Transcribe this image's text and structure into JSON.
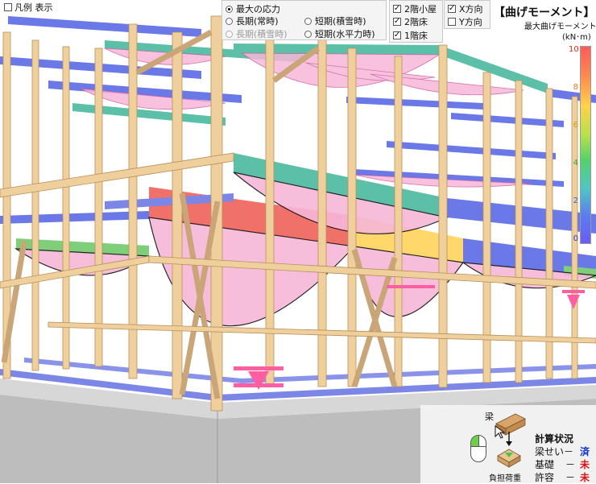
{
  "legend_toggle": {
    "label": "凡例 表示",
    "checked": false
  },
  "load_case": {
    "options": [
      {
        "label": "最大の応力",
        "selected": true,
        "enabled": true
      },
      {
        "label": "長期(常時)",
        "selected": false,
        "enabled": true
      },
      {
        "label": "短期(積雪時)",
        "selected": false,
        "enabled": true
      },
      {
        "label": "長期(積雪時)",
        "selected": false,
        "enabled": false
      },
      {
        "label": "短期(水平力時)",
        "selected": false,
        "enabled": true
      }
    ]
  },
  "floors": {
    "items": [
      {
        "label": "2階小屋",
        "checked": true
      },
      {
        "label": "2階床",
        "checked": true
      },
      {
        "label": "1階床",
        "checked": true
      }
    ]
  },
  "directions": {
    "items": [
      {
        "label": "X方向",
        "checked": true
      },
      {
        "label": "Y方向",
        "checked": false
      }
    ]
  },
  "color_scale": {
    "title": "【曲げモーメント】",
    "subtitle": "最大曲げモーメント",
    "unit": "(kN･m)",
    "ticks": [
      "10",
      "8",
      "6",
      "4",
      "2",
      "0"
    ],
    "tick_colors": [
      "#e0281e",
      "#e0781e",
      "#d0a000",
      "#3aa84a",
      "#2a6ad0",
      "#2a3ad0"
    ],
    "gradient": [
      "#ff5a5a",
      "#ff8a50",
      "#ffd24a",
      "#b7e04a",
      "#52d26b",
      "#4fc7c3",
      "#5b7cf0",
      "#6a5cf5"
    ]
  },
  "widget": {
    "beam_label": "梁",
    "load_label": "負担荷重",
    "status_title": "計算状況",
    "rows": [
      {
        "label": "梁せい",
        "dash": "－",
        "status": "済",
        "color": "#1030d0"
      },
      {
        "label": "基礎",
        "dash": "－",
        "status": "未",
        "color": "#e01010"
      },
      {
        "label": "許容",
        "dash": "－",
        "status": "未",
        "color": "#e01010"
      }
    ]
  },
  "colors": {
    "timber": "#efcf9c",
    "timber_edge": "#b98f5a",
    "moment_fill": "#f7b7d8",
    "moment_line": "#d05aa0",
    "beam_high": "#f0706a",
    "beam_mid": "#ffd76a",
    "beam_teal": "#5cc0a8",
    "beam_blue": "#6a78e8",
    "beam_green": "#7fcf7a",
    "foundation": "#b8b8b8"
  }
}
